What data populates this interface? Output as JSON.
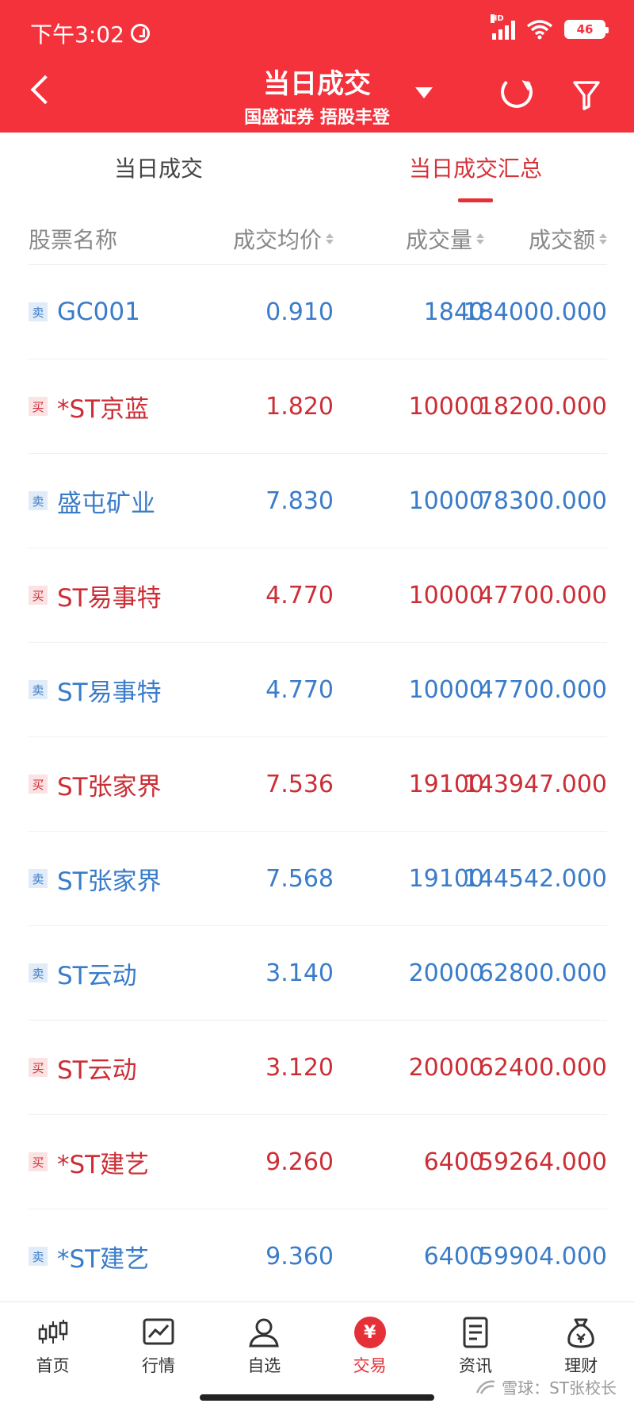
{
  "status_bar": {
    "time": "下午3:02",
    "hd": "HD",
    "battery": "46"
  },
  "header": {
    "title": "当日成交",
    "subtitle": "国盛证券 捂股丰登"
  },
  "tabs": [
    {
      "label": "当日成交",
      "active": false
    },
    {
      "label": "当日成交汇总",
      "active": true
    }
  ],
  "columns": [
    "股票名称",
    "成交均价",
    "成交量",
    "成交额"
  ],
  "rows": [
    {
      "side": "卖",
      "name": "GC001",
      "price": "0.910",
      "volume": "1840",
      "amount": "184000.000"
    },
    {
      "side": "买",
      "name": "*ST京蓝",
      "price": "1.820",
      "volume": "10000",
      "amount": "18200.000"
    },
    {
      "side": "卖",
      "name": "盛屯矿业",
      "price": "7.830",
      "volume": "10000",
      "amount": "78300.000"
    },
    {
      "side": "买",
      "name": "ST易事特",
      "price": "4.770",
      "volume": "10000",
      "amount": "47700.000"
    },
    {
      "side": "卖",
      "name": "ST易事特",
      "price": "4.770",
      "volume": "10000",
      "amount": "47700.000"
    },
    {
      "side": "买",
      "name": "ST张家界",
      "price": "7.536",
      "volume": "19100",
      "amount": "143947.000"
    },
    {
      "side": "卖",
      "name": "ST张家界",
      "price": "7.568",
      "volume": "19100",
      "amount": "144542.000"
    },
    {
      "side": "卖",
      "name": "ST云动",
      "price": "3.140",
      "volume": "20000",
      "amount": "62800.000"
    },
    {
      "side": "买",
      "name": "ST云动",
      "price": "3.120",
      "volume": "20000",
      "amount": "62400.000"
    },
    {
      "side": "买",
      "name": "*ST建艺",
      "price": "9.260",
      "volume": "6400",
      "amount": "59264.000"
    },
    {
      "side": "卖",
      "name": "*ST建艺",
      "price": "9.360",
      "volume": "6400",
      "amount": "59904.000"
    }
  ],
  "bottom_nav": [
    {
      "label": "首页",
      "icon": "candlestick-icon"
    },
    {
      "label": "行情",
      "icon": "chart-icon"
    },
    {
      "label": "自选",
      "icon": "user-icon"
    },
    {
      "label": "交易",
      "icon": "yen-icon",
      "active": true,
      "glyph": "¥"
    },
    {
      "label": "资讯",
      "icon": "document-icon"
    },
    {
      "label": "理财",
      "icon": "money-bag-icon"
    }
  ],
  "watermark": "雪球：ST张校长",
  "colors": {
    "brand_red": "#f3323c",
    "buy_red": "#cc2e36",
    "sell_blue": "#3a7cc9"
  }
}
